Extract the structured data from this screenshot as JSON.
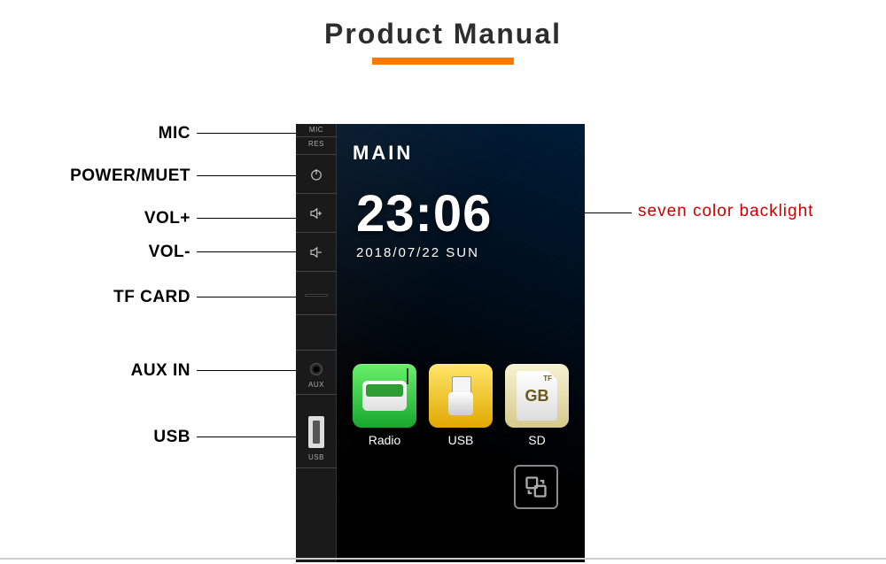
{
  "header": {
    "title": "Product  Manual"
  },
  "labels": {
    "mic": "MIC",
    "power": "POWER/MUET",
    "volup": "VOL+",
    "voldown": "VOL-",
    "tf": "TF CARD",
    "aux": "AUX IN",
    "usb": "USB",
    "backlight": "seven  color backlight"
  },
  "side": {
    "mic": "MIC",
    "res": "RES",
    "aux": "AUX",
    "usb": "USB"
  },
  "screen": {
    "title": "MAIN",
    "time": "23:06",
    "date": "2018/07/22   SUN"
  },
  "apps": {
    "radio": "Radio",
    "usb": "USB",
    "sd": "SD",
    "sd_text": "GB",
    "sd_tf": "TF"
  }
}
